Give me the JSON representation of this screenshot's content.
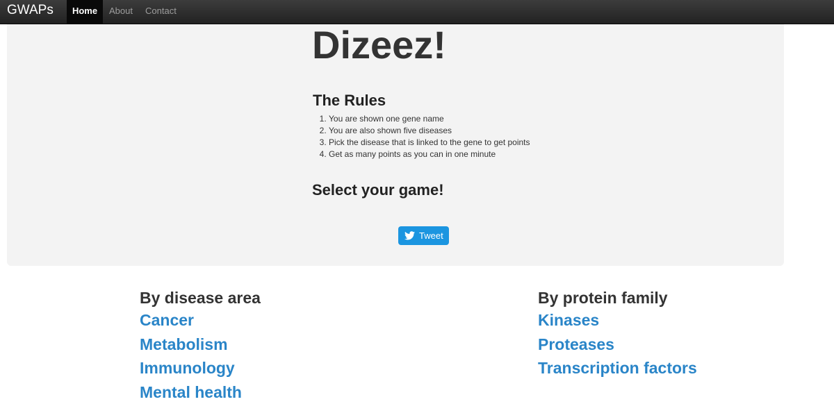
{
  "navbar": {
    "brand": "GWAPs",
    "items": [
      {
        "label": "Home",
        "active": true
      },
      {
        "label": "About",
        "active": false
      },
      {
        "label": "Contact",
        "active": false
      }
    ]
  },
  "jumbotron": {
    "title": "Dizeez!",
    "rules_heading": "The Rules",
    "rules": [
      "You are shown one gene name",
      "You are also shown five diseases",
      "Pick the disease that is linked to the gene to get points",
      "Get as many points as you can in one minute"
    ],
    "select_heading": "Select your game!",
    "tweet_button": {
      "label": "Tweet",
      "icon": "twitter-bird-icon",
      "color": "#1b95e0"
    }
  },
  "categories": {
    "disease_area": {
      "heading": "By disease area",
      "links": [
        "Cancer",
        "Metabolism",
        "Immunology",
        "Mental health"
      ]
    },
    "protein_family": {
      "heading": "By protein family",
      "links": [
        "Kinases",
        "Proteases",
        "Transcription factors"
      ]
    }
  },
  "colors": {
    "navbar": "#222222",
    "jumbotron": "#f3f3f3",
    "link": "#2a85c8"
  }
}
